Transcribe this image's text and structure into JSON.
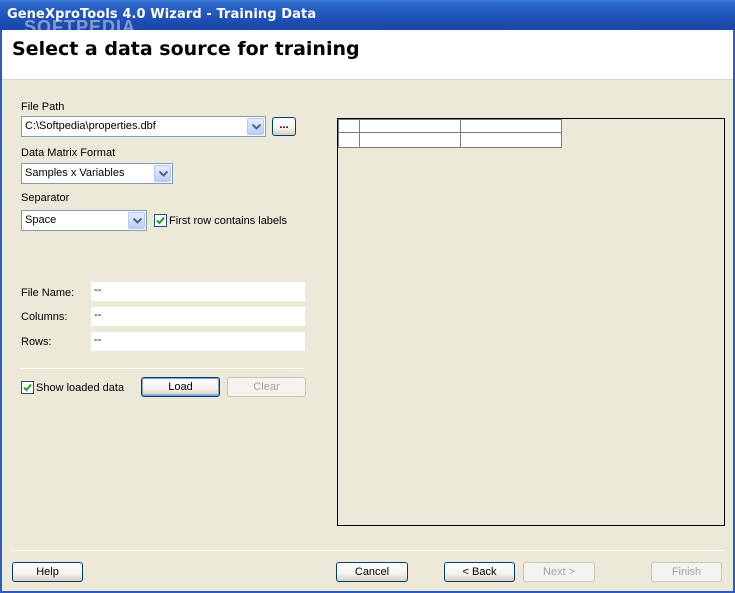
{
  "window": {
    "title": "GeneXproTools 4.0 Wizard - Training Data",
    "watermark": "SOFTPEDIA"
  },
  "header": {
    "title": "Select a data source for training"
  },
  "file_path": {
    "label": "File Path",
    "value": "C:\\Softpedia\\properties.dbf",
    "browse_label": "..."
  },
  "data_matrix_format": {
    "label": "Data Matrix Format",
    "value": "Samples x Variables"
  },
  "separator": {
    "label": "Separator",
    "value": "Space"
  },
  "first_row_labels": {
    "label": "First row contains labels",
    "checked": true
  },
  "info": {
    "file_name_label": "File Name:",
    "file_name_value": "--",
    "columns_label": "Columns:",
    "columns_value": "--",
    "rows_label": "Rows:",
    "rows_value": "--"
  },
  "show_loaded_data": {
    "label": "Show loaded data",
    "checked": true
  },
  "buttons": {
    "load": "Load",
    "clear": "Clear",
    "help": "Help",
    "cancel": "Cancel",
    "back": "< Back",
    "next": "Next >",
    "finish": "Finish"
  }
}
